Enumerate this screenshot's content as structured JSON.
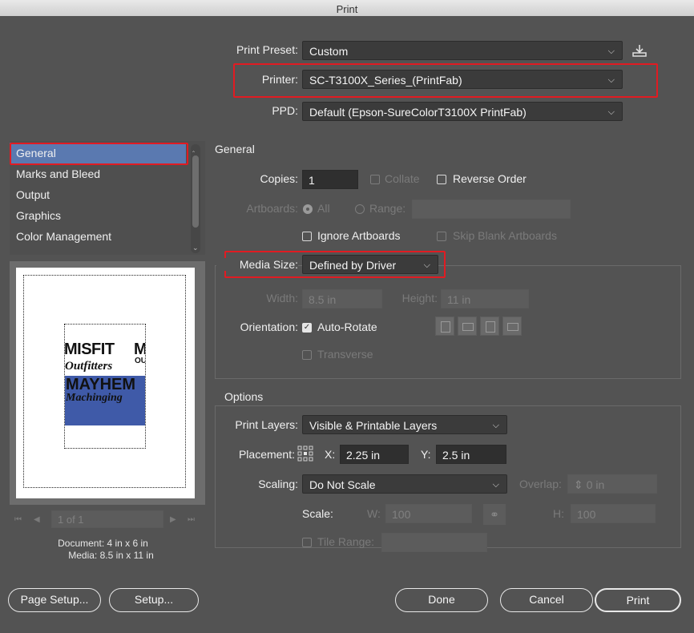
{
  "window": {
    "title": "Print"
  },
  "print_preset": {
    "label": "Print Preset:",
    "value": "Custom"
  },
  "printer": {
    "label": "Printer:",
    "value": "SC-T3100X_Series_(PrintFab)"
  },
  "ppd": {
    "label": "PPD:",
    "value": "Default (Epson-SureColorT3100X PrintFab)"
  },
  "sidebar": {
    "items": [
      {
        "label": "General",
        "selected": true
      },
      {
        "label": "Marks and Bleed"
      },
      {
        "label": "Output"
      },
      {
        "label": "Graphics"
      },
      {
        "label": "Color Management"
      }
    ]
  },
  "preview": {
    "artwork": {
      "line1": "MISFIT",
      "line1b": "M",
      "line2": "Outfitters",
      "line2b": "OU",
      "line3": "MAYHEM",
      "line4": "Machinging"
    },
    "nav": {
      "page": "1 of 1"
    },
    "document_info": "Document: 4 in x 6 in",
    "media_info": "Media: 8.5 in x 11 in",
    "colors": {
      "band": "#3f5aa8"
    }
  },
  "general": {
    "heading": "General",
    "copies_label": "Copies:",
    "copies_value": "1",
    "collate_label": "Collate",
    "reverse_order_label": "Reverse Order",
    "artboards_label": "Artboards:",
    "all_label": "All",
    "range_label": "Range:",
    "ignore_artboards_label": "Ignore Artboards",
    "skip_blank_label": "Skip Blank Artboards",
    "media_size_label": "Media Size:",
    "media_size_value": "Defined by Driver",
    "width_label": "Width:",
    "width_value": "8.5 in",
    "height_label": "Height:",
    "height_value": "11 in",
    "orientation_label": "Orientation:",
    "auto_rotate_label": "Auto-Rotate",
    "transverse_label": "Transverse"
  },
  "options": {
    "heading": "Options",
    "print_layers_label": "Print Layers:",
    "print_layers_value": "Visible & Printable Layers",
    "placement_label": "Placement:",
    "x_label": "X:",
    "x_value": "2.25 in",
    "y_label": "Y:",
    "y_value": "2.5 in",
    "scaling_label": "Scaling:",
    "scaling_value": "Do Not Scale",
    "overlap_label": "Overlap:",
    "overlap_value": "0 in",
    "scale_label": "Scale:",
    "w_label": "W:",
    "w_value": "100",
    "h_label": "H:",
    "h_value": "100",
    "tile_range_label": "Tile Range:"
  },
  "buttons": {
    "page_setup": "Page Setup...",
    "setup": "Setup...",
    "done": "Done",
    "cancel": "Cancel",
    "print": "Print"
  },
  "colors": {
    "highlight": "#e11b22",
    "selection": "#5a79b0",
    "background": "#535353"
  }
}
